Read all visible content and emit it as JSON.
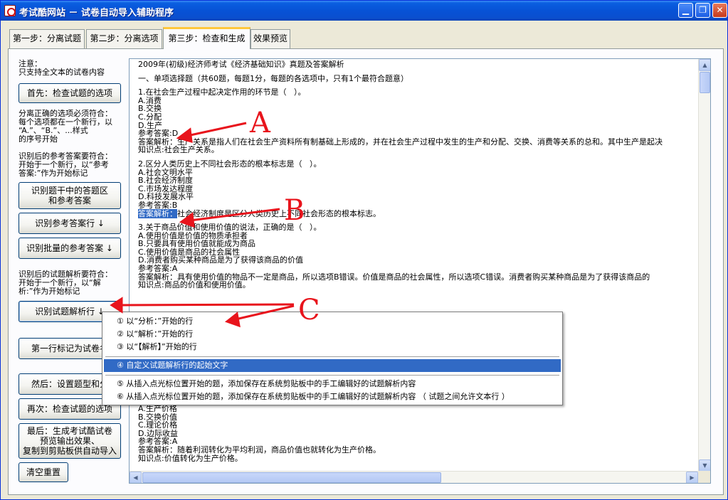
{
  "window": {
    "title": "考试酷网站 － 试卷自动导入辅助程序",
    "controls": {
      "minimize": "▁",
      "restore": "❐",
      "close": "✕"
    }
  },
  "tabs": [
    {
      "label": "第一步：分离试题"
    },
    {
      "label": "第二步：分离选项"
    },
    {
      "label": "第三步：检查和生成",
      "active": true
    },
    {
      "label": "效果预览"
    }
  ],
  "left": {
    "note_title": "注意：",
    "note_line": "只支持全文本的试卷内容",
    "btn_check_options": "首先：检查试题的选项",
    "note2": [
      "分离正确的选项必须符合：",
      "每个选项都在一个新行，以",
      "“A.”、“B.”、...样式",
      "的序号开始"
    ],
    "note3": [
      "识别后的参考答案要符合：",
      "开始于一个新行，以“参考",
      "答案:”作为开始标记"
    ],
    "btn_identify_answer_area": "识别题干中的答题区\n和参考答案",
    "btn_identify_answer_line": "识别参考答案行 ↓",
    "btn_identify_batch_answer": "识别批量的参考答案 ↓",
    "note4": [
      "识别后的试题解析要符合：",
      "开始于一个新行，以“解",
      "析:”作为开始标记"
    ],
    "btn_identify_analysis": "识别试题解析行 ↓",
    "btn_first_line_title": "第一行标记为试卷名",
    "btn_set_type": "然后：设置题型和分",
    "btn_check_again": "再次：检查试题的选项",
    "btn_generate": "最后：生成考试酷试卷\n预览输出效果、\n复制到剪贴板供自动导入",
    "btn_reset": "清空重置"
  },
  "content": {
    "lines": [
      "2009年(初级)经济师考试《经济基础知识》真题及答案解析",
      "",
      "一、单项选择题（共60题，每题1分，每题的各选项中，只有1个最符合题意）",
      "",
      "1.在社会生产过程中起决定作用的环节是（   ）。",
      "A.消费",
      "B.交换",
      "C.分配",
      "D.生产",
      "参考答案:D",
      "答案解析：生产关系是指人们在社会生产资料所有制基础上形成的，并在社会生产过程中发生的生产和分配、交换、消费等关系的总和。其中生产是起决",
      "知识点:社会生产关系。",
      "",
      "2.区分人类历史上不同社会形态的根本标志是（   ）。",
      "A.社会文明水平",
      "B.社会经济制度",
      "C.市场发达程度",
      "D.科技发展水平",
      "参考答案:B",
      "@@社会经济制度是区分人类历史上不同社会形态的根本标志。",
      "",
      "3.关于商品价值和使用价值的说法，正确的是（   ）。",
      "A.使用价值是价值的物质承担者",
      "B.只要具有使用价值就能成为商品",
      "C.使用价值是商品的社会属性",
      "D.消费者购买某种商品是为了获得该商品的价值",
      "参考答案:A",
      "答案解析：具有使用价值的物品不一定是商品，所以选项B错误。价值是商品的社会属性，所以选项C错误。消费者购买某种商品是为了获得该商品的",
      "知识点:商品的价值和使用价值。"
    ],
    "highlight": "答案解析：",
    "lines_bottom": [
      "A.生产价格",
      "B.交换价值",
      "C.理论价格",
      "D.边际收益",
      "参考答案:A",
      "答案解析：随着利润转化为平均利润，商品价值也就转化为生产价格。",
      "知识点:价值转化为生产价格。"
    ]
  },
  "context_menu": {
    "items": [
      "① 以“分析：”开始的行",
      "② 以“解析：”开始的行",
      "③ 以“【解析】”开始的行",
      "④ 自定义试题解析行的起始文字",
      "⑤ 从插入点光标位置开始的题，添加保存在系统剪贴板中的手工编辑好的试题解析内容",
      "⑥ 从插入点光标位置开始的题，添加保存在系统剪贴板中的手工编辑好的试题解析内容 （ 试题之间允许文本行 ）"
    ],
    "selected_index": 3
  },
  "annotations": {
    "a": "A",
    "b": "B",
    "c": "C",
    "color": "#e8141c"
  },
  "colors": {
    "selection": "#316ac5",
    "titlebar": "#0752d6",
    "tab_active_top": "#ffc83c"
  }
}
